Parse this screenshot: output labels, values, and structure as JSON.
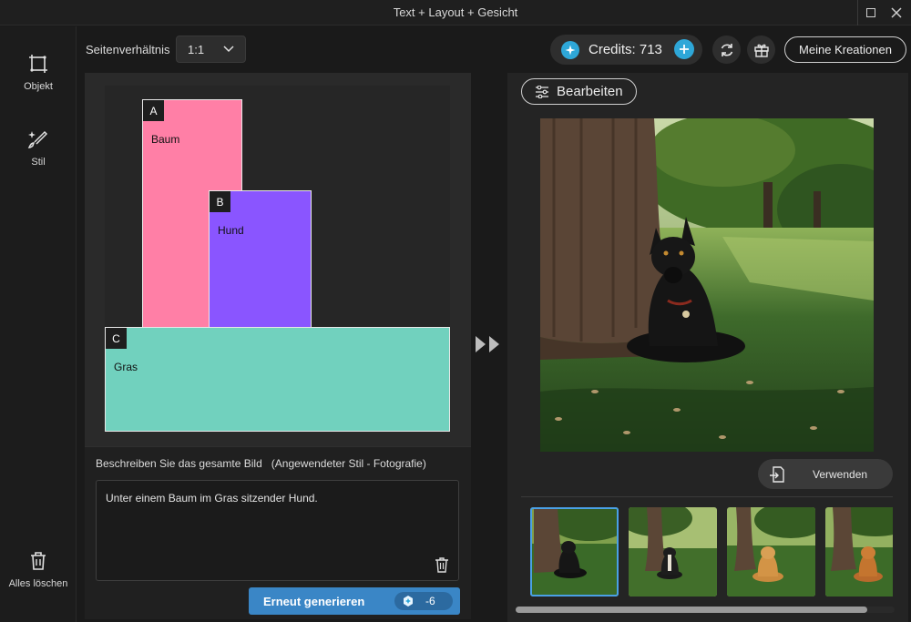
{
  "window": {
    "title": "Text + Layout + Gesicht"
  },
  "rail": {
    "items": [
      {
        "label": "Objekt",
        "icon": "object-crop-icon"
      },
      {
        "label": "Stil",
        "icon": "brush-sparkle-icon"
      }
    ],
    "clear_all": {
      "label": "Alles löschen",
      "icon": "trash-icon"
    }
  },
  "toolbar": {
    "aspect_label": "Seitenverhältnis",
    "aspect_value": "1:1"
  },
  "layout": {
    "regions": [
      {
        "tag": "A",
        "label": "Baum",
        "color": "#ff7fa6"
      },
      {
        "tag": "B",
        "label": "Hund",
        "color": "#8a55ff"
      },
      {
        "tag": "C",
        "label": "Gras",
        "color": "#71d1be"
      }
    ]
  },
  "prompt": {
    "heading": "Beschreiben Sie das gesamte Bild   (Angewendeter Stil - Fotografie)",
    "text": "Unter einem Baum im Gras sitzender Hund.",
    "regenerate_label": "Erneut generieren",
    "cost": "-6"
  },
  "header": {
    "credits_label": "Credits: 713",
    "my_creations_label": "Meine Kreationen"
  },
  "result": {
    "edit_label": "Bearbeiten",
    "use_label": "Verwenden",
    "thumbnails": [
      {
        "name": "thumbnail-1",
        "dog": "black dog",
        "selected": true
      },
      {
        "name": "thumbnail-2",
        "dog": "tricolor dog",
        "selected": false
      },
      {
        "name": "thumbnail-3",
        "dog": "golden retriever",
        "selected": false
      },
      {
        "name": "thumbnail-4",
        "dog": "golden retriever",
        "selected": false
      }
    ]
  },
  "colors": {
    "accent": "#3a86c6",
    "credit_gem": "#2ea7d8"
  }
}
